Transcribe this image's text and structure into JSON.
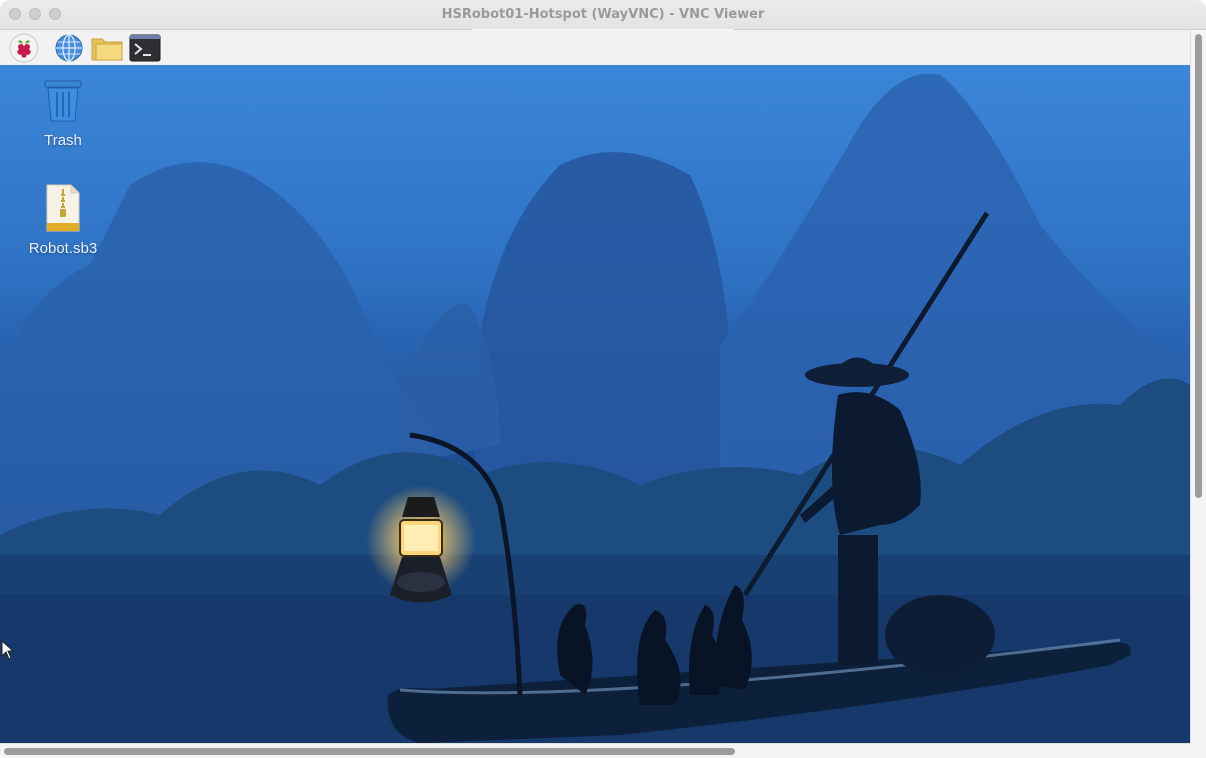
{
  "window": {
    "title": "HSRobot01-Hotspot (WayVNC) - VNC Viewer"
  },
  "panel": {
    "items": [
      {
        "name": "Raspberry Pi menu",
        "icon": "raspberry-icon"
      },
      {
        "name": "Web browser",
        "icon": "globe-icon"
      },
      {
        "name": "File manager",
        "icon": "folder-icon"
      },
      {
        "name": "Terminal",
        "icon": "terminal-icon"
      }
    ]
  },
  "desktop": {
    "icons": [
      {
        "label": "Trash",
        "icon": "trash-icon"
      },
      {
        "label": "Robot.sb3",
        "icon": "zip-file-icon"
      }
    ],
    "wallpaper": "karst-mountains-fisherman-photo"
  },
  "colors": {
    "sky": "#3b86d8",
    "water": "#143667",
    "lantern": "#ffd57a"
  },
  "scroll": {
    "vertical_fraction": 0.65,
    "horizontal_fraction": 0.61
  }
}
